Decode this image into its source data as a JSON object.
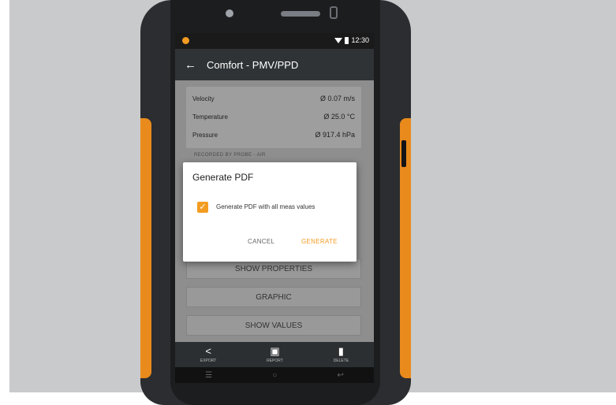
{
  "status_bar": {
    "time": "12:30"
  },
  "app_bar": {
    "title": "Comfort - PMV/PPD"
  },
  "readings": [
    {
      "label": "Velocity",
      "value": "Ø 0.07 m/s"
    },
    {
      "label": "Temperature",
      "value": "Ø 25.0 °C"
    },
    {
      "label": "Pressure",
      "value": "Ø 917.4 hPa"
    }
  ],
  "section_header": "RECORDED BY PROBE - AIR",
  "buttons": {
    "show_properties": "SHOW PROPERTIES",
    "graphic": "GRAPHIC",
    "show_values": "SHOW VALUES"
  },
  "dialog": {
    "title": "Generate PDF",
    "checkbox_label": "Generate PDF with all meas values",
    "checkbox_checked": true,
    "cancel": "CANCEL",
    "generate": "GENERATE"
  },
  "bottom_nav": [
    {
      "label": "EXPORT",
      "icon": "share-icon"
    },
    {
      "label": "REPORT",
      "icon": "report-icon"
    },
    {
      "label": "DELETE",
      "icon": "delete-icon"
    }
  ],
  "colors": {
    "accent": "#f39c22",
    "app_bar": "#303336",
    "bumper": "#e98a1c"
  }
}
